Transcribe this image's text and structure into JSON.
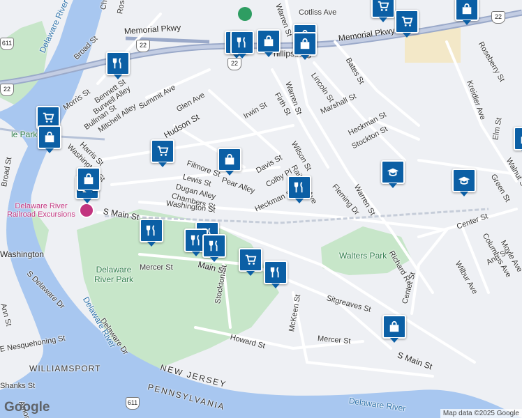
{
  "map": {
    "title": "Phillipsburg",
    "attribution": "Map data ©2025 Google",
    "logo": "Google",
    "colors": {
      "water": "#a8c7f0",
      "park": "#c7e6c9",
      "road": "#ffffff",
      "highway": "#9aa9c9",
      "land": "#eef0f4",
      "pin": "#0b5fa5"
    }
  },
  "streets": [
    "Cotliss Ave",
    "Memorial Pkwy",
    "Memorial Pkwy",
    "Broad St",
    "Morris St",
    "Bennett St",
    "Burwell Alley",
    "Bullman St",
    "Mitchell Alley",
    "Summit Ave",
    "Glen Ave",
    "Hudson St",
    "Harris St",
    "Washington St",
    "Filmore St",
    "Pear Alley",
    "Lewis St",
    "Dugan Alley",
    "Chambers St",
    "Davis St",
    "Colby Pl",
    "Irwin St",
    "Firth St",
    "Warren St",
    "Lincoln St",
    "Marshall St",
    "Bates St",
    "Heckman St",
    "Stockton St",
    "Wilson St",
    "Railroad Ave",
    "Heckman St",
    "Fleming Dr",
    "Warren St",
    "Washington St",
    "S Main St",
    "Main St",
    "Mercer St",
    "Stockton St",
    "Sitgreaves St",
    "Richard Rd",
    "Center St",
    "Center St",
    "Howard St",
    "McKeen St",
    "Mercer St",
    "S Main St",
    "Kreidler Ave",
    "Roseberry St",
    "Elm St",
    "Green St",
    "Columbus Ave",
    "Wilbur Ave",
    "Ann St",
    "Moyle Ave",
    "Walnut St",
    "S Delaware Dr",
    "Delaware Dr",
    "E Nesquehoning St",
    "Ann St",
    "Shanks St",
    "Amos St",
    "Chimney St",
    "Rose St",
    "Broad St",
    "Warren St",
    "Washington"
  ],
  "places": {
    "river": "Delaware River",
    "river2": "Delaware River",
    "river3": "Delaware River",
    "park1": "Delaware River Park",
    "park2": "Walters Park",
    "poi": "Delaware River Railroad Excursions",
    "state_nj": "NEW JERSEY",
    "state_pa": "PENNSYLVANIA",
    "town": "WILLIAMSPORT",
    "park_edge": "le Park",
    "city": "hillipsburg"
  },
  "shields": [
    "611",
    "22",
    "22",
    "22",
    "22",
    "611"
  ],
  "pins": [
    {
      "type": "grocery-icon"
    },
    {
      "type": "shopping-bag-icon"
    },
    {
      "type": "grocery-icon"
    },
    {
      "type": "shopping-bag-icon"
    },
    {
      "type": "restaurant-icon"
    },
    {
      "type": "restaurant-icon"
    },
    {
      "type": "shopping-bag-icon"
    },
    {
      "type": "shopping-bag-icon"
    },
    {
      "type": "restaurant-icon"
    },
    {
      "type": "grocery-icon"
    },
    {
      "type": "shopping-bag-icon"
    },
    {
      "type": "grocery-icon"
    },
    {
      "type": "shopping-bag-icon"
    },
    {
      "type": "restaurant-icon"
    },
    {
      "type": "school-icon"
    },
    {
      "type": "school-icon"
    },
    {
      "type": "shopping-bag-icon"
    },
    {
      "type": "restaurant-icon"
    },
    {
      "type": "restaurant-icon"
    },
    {
      "type": "restaurant-icon"
    },
    {
      "type": "restaurant-icon"
    },
    {
      "type": "grocery-icon"
    },
    {
      "type": "restaurant-icon"
    },
    {
      "type": "shopping-bag-icon"
    },
    {
      "type": "shopping-bag-icon"
    },
    {
      "type": "shopping-bag-icon"
    }
  ]
}
